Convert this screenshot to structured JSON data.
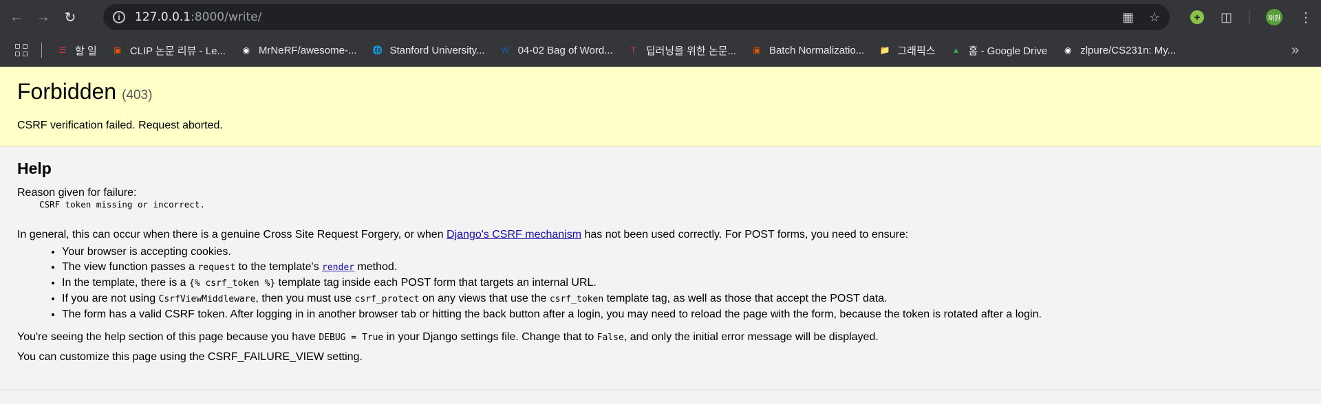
{
  "browser": {
    "url_host": "127.0.0.1",
    "url_rest": ":8000/write/",
    "avatar_text": "재원"
  },
  "bookmarks": [
    {
      "label": "할 일",
      "icon": "checklist-icon",
      "color": "#e53935"
    },
    {
      "label": "CLIP 논문 리뷰 - Le...",
      "icon": "blog-icon",
      "color": "#e65100"
    },
    {
      "label": "MrNeRF/awesome-...",
      "icon": "github-icon",
      "color": "#ffffff"
    },
    {
      "label": "Stanford University...",
      "icon": "globe-icon",
      "color": "#ffffff"
    },
    {
      "label": "04-02 Bag of Word...",
      "icon": "wikidocs-icon",
      "color": "#1565c0"
    },
    {
      "label": "딥러닝을 위한 논문...",
      "icon": "tistory-icon",
      "color": "#e53935"
    },
    {
      "label": "Batch Normalizatio...",
      "icon": "blog-icon",
      "color": "#e65100"
    },
    {
      "label": "그래픽스",
      "icon": "folder-icon",
      "color": "#c4c7c5"
    },
    {
      "label": "홈 - Google Drive",
      "icon": "google-drive-icon",
      "color": "#34a853"
    },
    {
      "label": "zlpure/CS231n: My...",
      "icon": "github-icon",
      "color": "#ffffff"
    }
  ],
  "summary": {
    "title": "Forbidden",
    "code": "(403)",
    "message": "CSRF verification failed. Request aborted."
  },
  "help": {
    "heading": "Help",
    "reason_label": "Reason given for failure:",
    "reason": "CSRF token missing or incorrect.",
    "general_before": "In general, this can occur when there is a genuine Cross Site Request Forgery, or when ",
    "general_link": "Django's CSRF mechanism",
    "general_after": " has not been used correctly. For POST forms, you need to ensure:",
    "items": {
      "cookies": "Your browser is accepting cookies.",
      "view_a": "The view function passes a ",
      "view_code": "request",
      "view_b": " to the template's ",
      "view_link": "render",
      "view_c": " method.",
      "tag_a": "In the template, there is a ",
      "tag_code": "{% csrf_token %}",
      "tag_b": " template tag inside each POST form that targets an internal URL.",
      "mw_a": "If you are not using ",
      "mw_code1": "CsrfViewMiddleware",
      "mw_b": ", then you must use ",
      "mw_code2": "csrf_protect",
      "mw_c": " on any views that use the ",
      "mw_code3": "csrf_token",
      "mw_d": " template tag, as well as those that accept the POST data.",
      "valid": "The form has a valid CSRF token. After logging in in another browser tab or hitting the back button after a login, you may need to reload the page with the form, because the token is rotated after a login."
    },
    "debug_a": "You're seeing the help section of this page because you have ",
    "debug_code1": "DEBUG = True",
    "debug_b": " in your Django settings file. Change that to ",
    "debug_code2": "False",
    "debug_c": ", and only the initial error message will be displayed.",
    "customize": "You can customize this page using the CSRF_FAILURE_VIEW setting."
  }
}
